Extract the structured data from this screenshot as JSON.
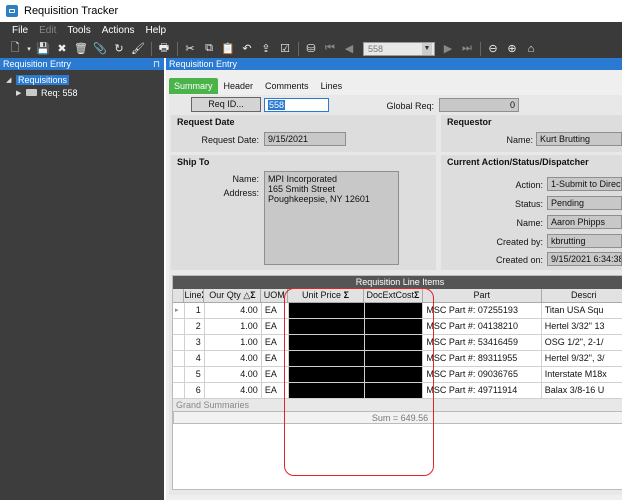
{
  "window": {
    "title": "Requisition Tracker"
  },
  "menu": [
    "File",
    "Edit",
    "Tools",
    "Actions",
    "Help"
  ],
  "toolbar": {
    "record_value": "558"
  },
  "left_panel": {
    "title": "Requisition Entry",
    "pin": "⊓",
    "tree": [
      {
        "label": "Requisitions"
      },
      {
        "label": "Req: 558"
      }
    ]
  },
  "right_panel": {
    "title": "Requisition Entry"
  },
  "tabs": [
    "Summary",
    "Header",
    "Comments",
    "Lines"
  ],
  "form": {
    "req_id_button": "Req ID...",
    "req_id_value": "558",
    "global_req_label": "Global Req:",
    "global_req_value": "0",
    "request_date_title": "Request Date",
    "request_date_label": "Request Date:",
    "request_date_value": "9/15/2021",
    "requestor_title": "Requestor",
    "requestor_name_label": "Name:",
    "requestor_name_value": "Kurt Brutting",
    "ship_to_title": "Ship To",
    "ship_name_label": "Name:",
    "ship_address_label": "Address:",
    "ship_lines": [
      "MPI Incorporated",
      "165 Smith Street",
      "Poughkeepsie, NY  12601"
    ],
    "current_action_title": "Current Action/Status/Dispatcher",
    "action_label": "Action:",
    "action_value": "1-Submit to Direct",
    "status_label": "Status:",
    "status_value": "Pending",
    "dispatcher_name_label": "Name:",
    "dispatcher_name_value": "Aaron Phipps",
    "created_by_label": "Created by:",
    "created_by_value": "kbrutting",
    "created_on_label": "Created on:",
    "created_on_value": "9/15/2021 6:34:38 A"
  },
  "grid": {
    "title": "Requisition Line Items",
    "headers": [
      "Line",
      "Our Qty",
      "UOM",
      "Unit Price",
      "DocExtCost",
      "Part",
      "Descri"
    ],
    "rows": [
      {
        "line": "1",
        "qty": "4.00",
        "uom": "EA",
        "part": "MSC Part #: 07255193",
        "desc": "Titan USA Squ"
      },
      {
        "line": "2",
        "qty": "1.00",
        "uom": "EA",
        "part": "MSC Part #: 04138210",
        "desc": "Hertel 3/32\" 13"
      },
      {
        "line": "3",
        "qty": "1.00",
        "uom": "EA",
        "part": "MSC Part #: 53416459",
        "desc": "OSG 1/2\", 2-1/"
      },
      {
        "line": "4",
        "qty": "4.00",
        "uom": "EA",
        "part": "MSC Part #: 89311955",
        "desc": "Hertel 9/32\", 3/"
      },
      {
        "line": "5",
        "qty": "4.00",
        "uom": "EA",
        "part": "MSC Part #: 09036765",
        "desc": "Interstate M18x"
      },
      {
        "line": "6",
        "qty": "4.00",
        "uom": "EA",
        "part": "MSC Part #: 49711914",
        "desc": "Balax 3/8-16 U"
      }
    ],
    "grand_summaries": "Grand Summaries",
    "sum_text": "Sum = 649.56"
  },
  "colors": {
    "accent": "#2a7ad1",
    "tab_active": "#4ab44a",
    "annotation": "#e2232a"
  }
}
